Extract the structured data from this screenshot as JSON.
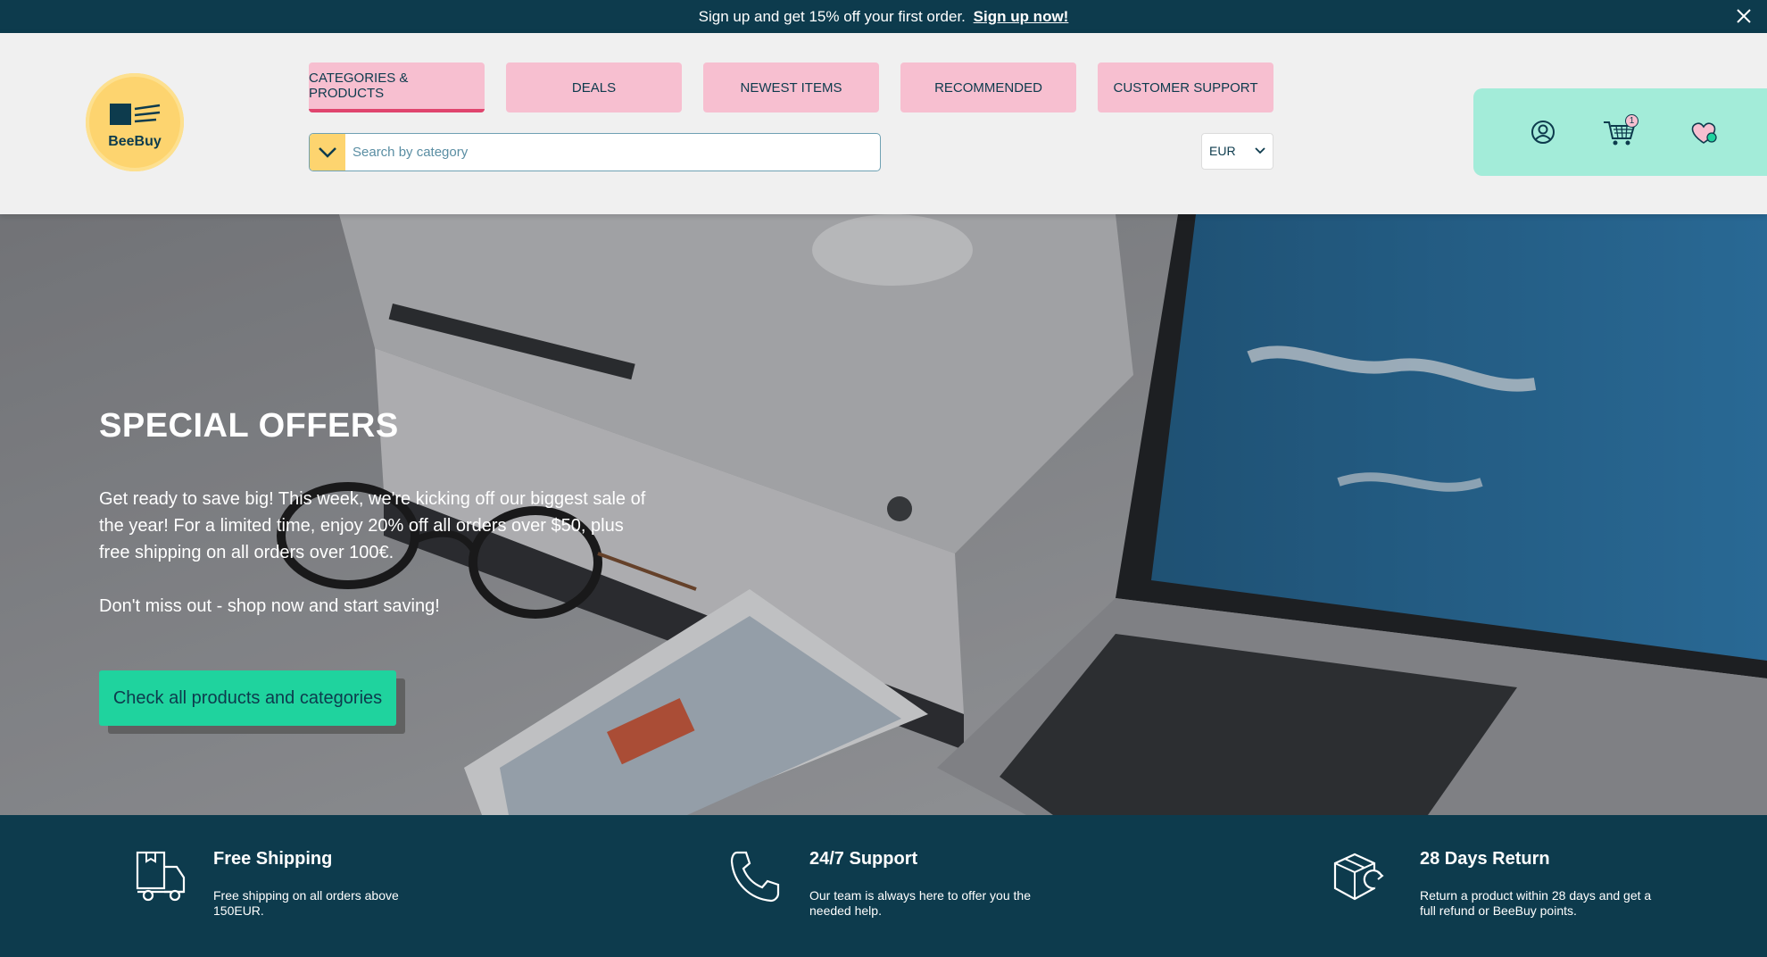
{
  "promo": {
    "text": "Sign up and get 15% off your first order.",
    "link": "Sign up now!"
  },
  "brand": {
    "name": "BeeBuy"
  },
  "nav": {
    "tabs": [
      {
        "label": "CATEGORIES & PRODUCTS",
        "active": true
      },
      {
        "label": "DEALS"
      },
      {
        "label": "NEWEST ITEMS"
      },
      {
        "label": "RECOMMENDED"
      },
      {
        "label": "CUSTOMER SUPPORT"
      }
    ]
  },
  "search": {
    "placeholder": "Search by category",
    "value": ""
  },
  "currency": {
    "selected": "EUR"
  },
  "header_icons": {
    "account": "user-circle-icon",
    "cart": "shopping-cart-icon",
    "cart_count": "1",
    "wishlist": "heart-icon"
  },
  "hero": {
    "title": "SPECIAL OFFERS",
    "paragraph1": "Get ready to save big! This week, we're kicking off our biggest sale of the year! For a limited time, enjoy 20% off all orders over $50, plus  free shipping on all orders over 100€.",
    "paragraph2": "Don't miss out - shop now and start saving!",
    "cta": "Check all products and categories"
  },
  "features": [
    {
      "icon": "delivery-truck-icon",
      "title": "Free Shipping",
      "desc": "Free shipping on all orders above 150EUR."
    },
    {
      "icon": "phone-icon",
      "title": "24/7 Support",
      "desc": "Our team is always here to offer you the needed help."
    },
    {
      "icon": "return-box-icon",
      "title": "28 Days Return",
      "desc": "Return a product within 28 days and get a full refund or BeeBuy points."
    }
  ],
  "colors": {
    "dark": "#0d3b4d",
    "pink": "#f7bfd0",
    "accent_pink": "#e0456e",
    "yellow": "#fdd46f",
    "mint": "#a3ecd9",
    "green": "#1fd39e"
  }
}
